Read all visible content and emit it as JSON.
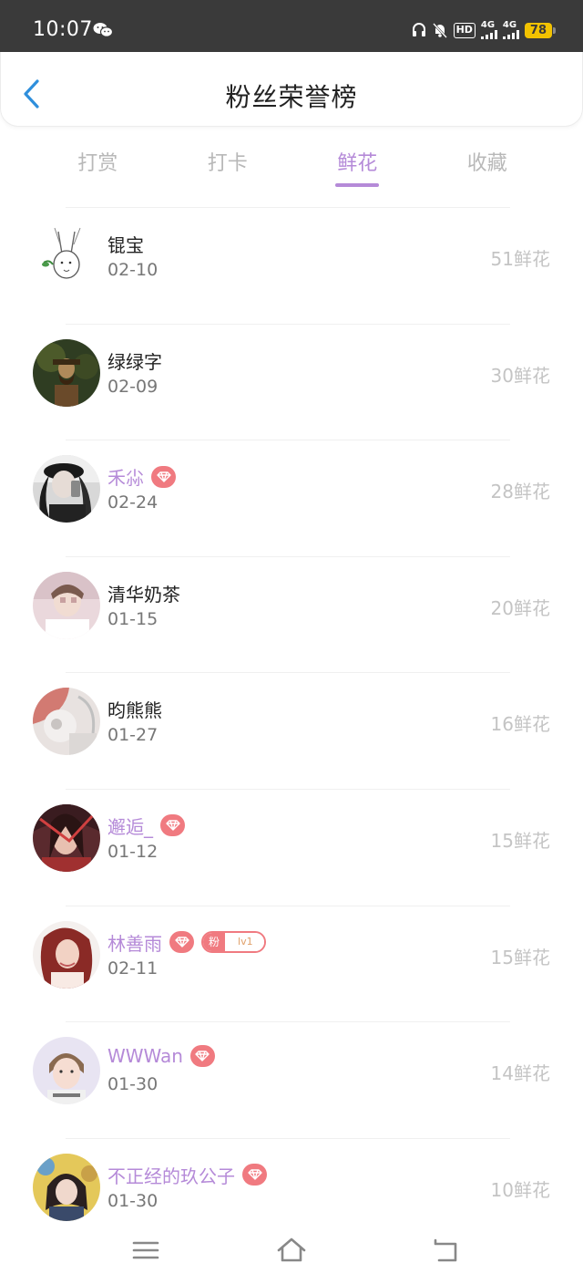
{
  "status_bar": {
    "time": "10:07",
    "network1": "4G",
    "network2": "4G",
    "hd": "HD",
    "battery": "78"
  },
  "header": {
    "title": "粉丝荣誉榜"
  },
  "tabs": [
    {
      "label": "打赏"
    },
    {
      "label": "打卡"
    },
    {
      "label": "鲜花"
    },
    {
      "label": "收藏"
    }
  ],
  "active_tab": "鲜花",
  "colors": {
    "accent": "#b58ad8",
    "badge": "#f07a80",
    "count": "#c4c4c4"
  },
  "list": [
    {
      "name": "锟宝",
      "date": "02-10",
      "count": "51鲜花",
      "vip": false
    },
    {
      "name": "绿绿字",
      "date": "02-09",
      "count": "30鲜花",
      "vip": false
    },
    {
      "name": "禾尛",
      "date": "02-24",
      "count": "28鲜花",
      "vip": true
    },
    {
      "name": "清华奶茶",
      "date": "01-15",
      "count": "20鲜花",
      "vip": false
    },
    {
      "name": "昀熊熊",
      "date": "01-27",
      "count": "16鲜花",
      "vip": false
    },
    {
      "name": "邂逅_",
      "date": "01-12",
      "count": "15鲜花",
      "vip": true
    },
    {
      "name": "林善雨",
      "date": "02-11",
      "count": "15鲜花",
      "vip": true,
      "fan_badge": {
        "label": "粉",
        "level": "lv1"
      }
    },
    {
      "name": "WWWan",
      "date": "01-30",
      "count": "14鲜花",
      "vip": true
    },
    {
      "name": "不正经的玖公子",
      "date": "01-30",
      "count": "10鲜花",
      "vip": true
    }
  ]
}
